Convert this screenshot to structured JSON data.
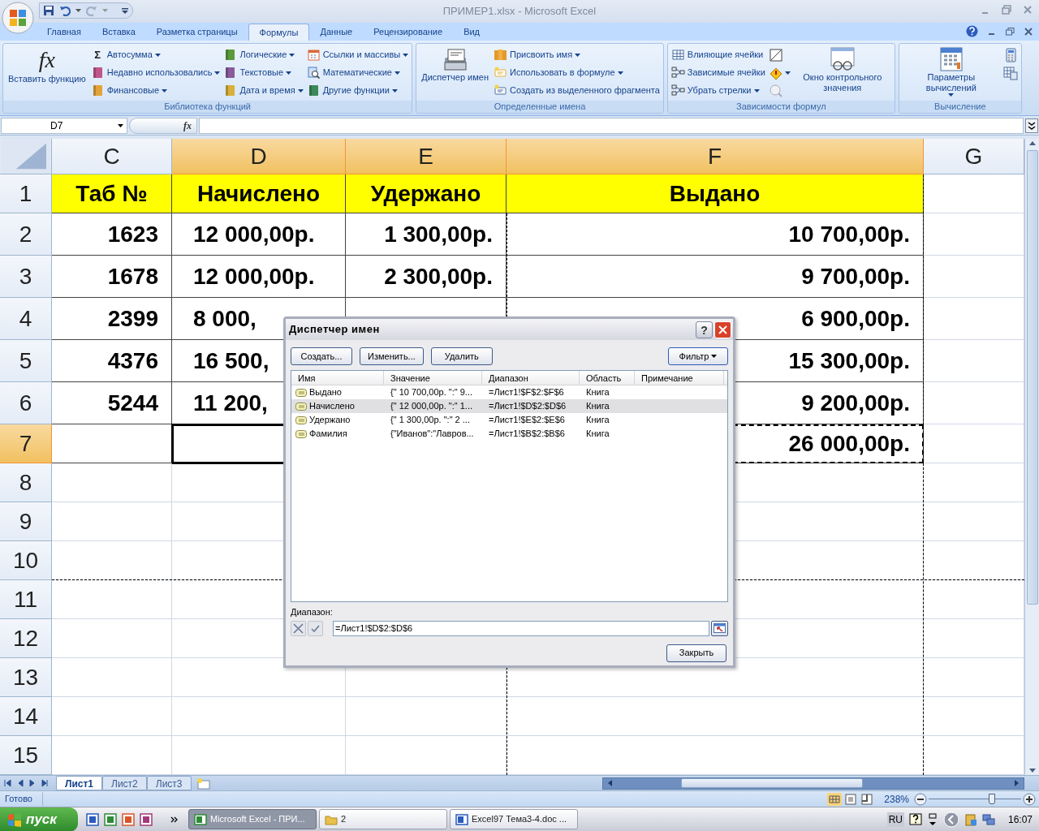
{
  "window": {
    "title": "ПРИМЕР1.xlsx - Microsoft Excel"
  },
  "ribbon_tabs": [
    {
      "label": "Главная",
      "selected": false
    },
    {
      "label": "Вставка",
      "selected": false
    },
    {
      "label": "Разметка страницы",
      "selected": false
    },
    {
      "label": "Формулы",
      "selected": true
    },
    {
      "label": "Данные",
      "selected": false
    },
    {
      "label": "Рецензирование",
      "selected": false
    },
    {
      "label": "Вид",
      "selected": false
    }
  ],
  "ribbon_groups": [
    {
      "label": "Библиотека функций",
      "parts": [
        {
          "kind": "large",
          "label": "Вставить функцию",
          "icon_text": "fx",
          "dropdown": false
        },
        {
          "kind": "column",
          "items": [
            {
              "label": "Автосумма",
              "icon_text": "Σ",
              "dropdown": true
            },
            {
              "label": "Недавно использовались",
              "dropdown": true
            },
            {
              "label": "Финансовые",
              "dropdown": true
            }
          ]
        },
        {
          "kind": "column",
          "items": [
            {
              "label": "Логические",
              "dropdown": true
            },
            {
              "label": "Текстовые",
              "dropdown": true
            },
            {
              "label": "Дата и время",
              "dropdown": true
            }
          ]
        },
        {
          "kind": "column",
          "items": [
            {
              "label": "Ссылки и массивы",
              "dropdown": true
            },
            {
              "label": "Математические",
              "dropdown": true
            },
            {
              "label": "Другие функции",
              "dropdown": true
            }
          ]
        }
      ]
    },
    {
      "label": "Определенные имена",
      "parts": [
        {
          "kind": "large",
          "label": "Диспетчер имен",
          "dropdown": false
        },
        {
          "kind": "column",
          "items": [
            {
              "label": "Присвоить имя",
              "dropdown": true
            },
            {
              "label": "Использовать в формуле",
              "dropdown": true
            },
            {
              "label": "Создать из выделенного фрагмента",
              "dropdown": false
            }
          ]
        }
      ]
    },
    {
      "label": "Зависимости формул",
      "parts": [
        {
          "kind": "column",
          "items": [
            {
              "label": "Влияющие ячейки",
              "dropdown": false
            },
            {
              "label": "Зависимые ячейки",
              "dropdown": false
            },
            {
              "label": "Убрать стрелки",
              "dropdown": true
            }
          ]
        },
        {
          "kind": "icons",
          "items": [
            {
              "dropdown": false
            },
            {
              "dropdown": true
            },
            {
              "dropdown": false
            }
          ]
        },
        {
          "kind": "large",
          "label": "Окно контрольного значения",
          "dropdown": false
        }
      ]
    },
    {
      "label": "Вычисление",
      "parts": [
        {
          "kind": "large",
          "label": "Параметры вычислений",
          "dropdown": true
        },
        {
          "kind": "icons",
          "items": [
            {
              "dropdown": false
            },
            {
              "dropdown": false
            }
          ]
        }
      ]
    }
  ],
  "formula_bar": {
    "name_box": "D7",
    "fx": "fx"
  },
  "columns": [
    {
      "label": "C",
      "highlighted": false
    },
    {
      "label": "D",
      "highlighted": true
    },
    {
      "label": "E",
      "highlighted": true
    },
    {
      "label": "F",
      "highlighted": true
    },
    {
      "label": "G",
      "highlighted": false
    }
  ],
  "rows": [
    {
      "number": "1",
      "highlighted": false,
      "kind": "header",
      "cells": [
        {
          "text": "Таб №",
          "selected": false,
          "marquee": false
        },
        {
          "text": "Начислено",
          "selected": false,
          "marquee": false
        },
        {
          "text": "Удержано",
          "selected": false,
          "marquee": false
        },
        {
          "text": "Выдано",
          "selected": false,
          "marquee": false
        },
        {
          "selected": false,
          "marquee": false
        }
      ]
    },
    {
      "number": "2",
      "highlighted": false,
      "kind": "data",
      "cells": [
        {
          "text": "1623",
          "selected": false,
          "marquee": false
        },
        {
          "text": "12 000,00р.",
          "selected": false,
          "marquee": false
        },
        {
          "text": "1 300,00р.",
          "selected": false,
          "marquee": false
        },
        {
          "text": "10 700,00р.",
          "selected": false,
          "marquee": false
        },
        {
          "selected": false,
          "marquee": false
        }
      ]
    },
    {
      "number": "3",
      "highlighted": false,
      "kind": "data",
      "cells": [
        {
          "text": "1678",
          "selected": false,
          "marquee": false
        },
        {
          "text": "12 000,00р.",
          "selected": false,
          "marquee": false
        },
        {
          "text": "2 300,00р.",
          "selected": false,
          "marquee": false
        },
        {
          "text": "9 700,00р.",
          "selected": false,
          "marquee": false
        },
        {
          "selected": false,
          "marquee": false
        }
      ]
    },
    {
      "number": "4",
      "highlighted": false,
      "kind": "data",
      "cells": [
        {
          "text": "2399",
          "selected": false,
          "marquee": false
        },
        {
          "text": "8 000,",
          "selected": false,
          "marquee": false
        },
        {},
        {
          "text": "6 900,00р.",
          "selected": false,
          "marquee": false
        },
        {
          "selected": false,
          "marquee": false
        }
      ]
    },
    {
      "number": "5",
      "highlighted": false,
      "kind": "data",
      "cells": [
        {
          "text": "4376",
          "selected": false,
          "marquee": false
        },
        {
          "text": "16 500,",
          "selected": false,
          "marquee": false
        },
        {},
        {
          "text": "15 300,00р.",
          "selected": false,
          "marquee": false
        },
        {
          "selected": false,
          "marquee": false
        }
      ]
    },
    {
      "number": "6",
      "highlighted": false,
      "kind": "data",
      "cells": [
        {
          "text": "5244",
          "selected": false,
          "marquee": false
        },
        {
          "text": "11 200,",
          "selected": false,
          "marquee": false
        },
        {},
        {
          "text": "9 200,00р.",
          "selected": false,
          "marquee": false
        },
        {
          "selected": false,
          "marquee": false
        }
      ]
    },
    {
      "number": "7",
      "highlighted": true,
      "kind": "data",
      "cells": [
        {
          "selected": false,
          "marquee": false
        },
        {
          "selected": true,
          "marquee": false
        },
        {},
        {
          "text": "26 000,00р.",
          "selected": false,
          "marquee": true
        },
        {
          "selected": false,
          "marquee": false
        }
      ]
    },
    {
      "number": "8",
      "highlighted": false,
      "kind": "empty"
    },
    {
      "number": "9",
      "highlighted": false,
      "kind": "empty"
    },
    {
      "number": "10",
      "highlighted": false,
      "kind": "empty"
    },
    {
      "number": "11",
      "highlighted": false,
      "kind": "empty"
    },
    {
      "number": "12",
      "highlighted": false,
      "kind": "empty"
    },
    {
      "number": "13",
      "highlighted": false,
      "kind": "empty"
    },
    {
      "number": "14",
      "highlighted": false,
      "kind": "empty"
    },
    {
      "number": "15",
      "highlighted": false,
      "kind": "empty"
    }
  ],
  "dialog": {
    "title": "Диспетчер имен",
    "help": "?",
    "buttons": [
      "Создать...",
      "Изменить...",
      "Удалить"
    ],
    "filter": "Фильтр",
    "columns": [
      "Имя",
      "Значение",
      "Диапазон",
      "Область",
      "Примечание"
    ],
    "items": [
      {
        "name": "Выдано",
        "value": "{\" 10 700,00р. \":\" 9...",
        "range": "=Лист1!$F$2:$F$6",
        "scope": "Книга",
        "selected": false
      },
      {
        "name": "Начислено",
        "value": "{\" 12 000,00р. \":\" 1...",
        "range": "=Лист1!$D$2:$D$6",
        "scope": "Книга",
        "selected": true
      },
      {
        "name": "Удержано",
        "value": "{\" 1 300,00р. \":\" 2 ...",
        "range": "=Лист1!$E$2:$E$6",
        "scope": "Книга",
        "selected": false
      },
      {
        "name": "Фамилия",
        "value": "{\"Иванов\":\"Лавров...",
        "range": "=Лист1!$B$2:$B$6",
        "scope": "Книга",
        "selected": false
      }
    ],
    "range_label": "Диапазон:",
    "range_value": "=Лист1!$D$2:$D$6",
    "close": "Закрыть"
  },
  "sheet_tabs": [
    {
      "label": "Лист1",
      "selected": true
    },
    {
      "label": "Лист2",
      "selected": false
    },
    {
      "label": "Лист3",
      "selected": false
    }
  ],
  "status_bar": {
    "text": "Готово",
    "zoom": "238%",
    "zoom_slider": {
      "level": 0.68
    }
  },
  "taskbar": {
    "start": "пуск",
    "tasks": [
      {
        "label": "Microsoft Excel - ПРИ...",
        "active": true
      },
      {
        "label": "2",
        "active": false
      },
      {
        "label": "Excel97 Тема3-4.doc ...",
        "active": false
      }
    ],
    "language": "RU",
    "clock": "16:07"
  }
}
